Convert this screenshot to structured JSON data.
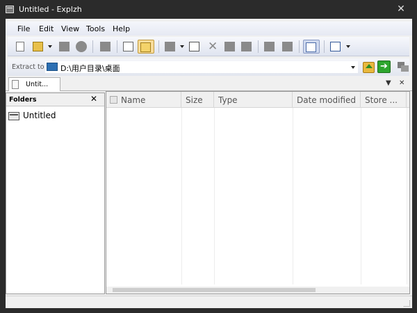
{
  "window": {
    "title": "Untitled - Explzh",
    "close_glyph": "✕"
  },
  "menu": [
    {
      "label": "File"
    },
    {
      "label": "Edit"
    },
    {
      "label": "View"
    },
    {
      "label": "Tools"
    },
    {
      "label": "Help"
    }
  ],
  "extract": {
    "label": "Extract to",
    "path": "D:\\用户目录\\桌面",
    "go_glyph": "➔"
  },
  "tabs": {
    "active_label": "Untit...",
    "menu_glyph": "▼",
    "close_glyph": "✕"
  },
  "folders": {
    "title": "Folders",
    "close_glyph": "✕",
    "items": [
      {
        "label": "Untitled"
      }
    ]
  },
  "list": {
    "columns": [
      {
        "label": "Name"
      },
      {
        "label": "Size"
      },
      {
        "label": "Type"
      },
      {
        "label": "Date modified"
      },
      {
        "label": "Store ..."
      }
    ]
  },
  "icons": {
    "toolbar": [
      "new-archive-icon",
      "open-archive-icon",
      "close-archive-icon",
      "stop-icon",
      "extract-icon",
      "view-comment-icon",
      "open-folder-icon",
      "add-files-icon",
      "add-dropdown-icon",
      "archive-test-icon",
      "delete-icon",
      "copy-icon",
      "paste-icon",
      "previous-icon",
      "next-icon",
      "preview-icon",
      "view-mode-icon",
      "view-mode-dropdown-icon"
    ]
  },
  "colors": {
    "title_bg": "#2b2b2b",
    "active_button": "#f8dc9b",
    "go_green": "#2da52d"
  }
}
